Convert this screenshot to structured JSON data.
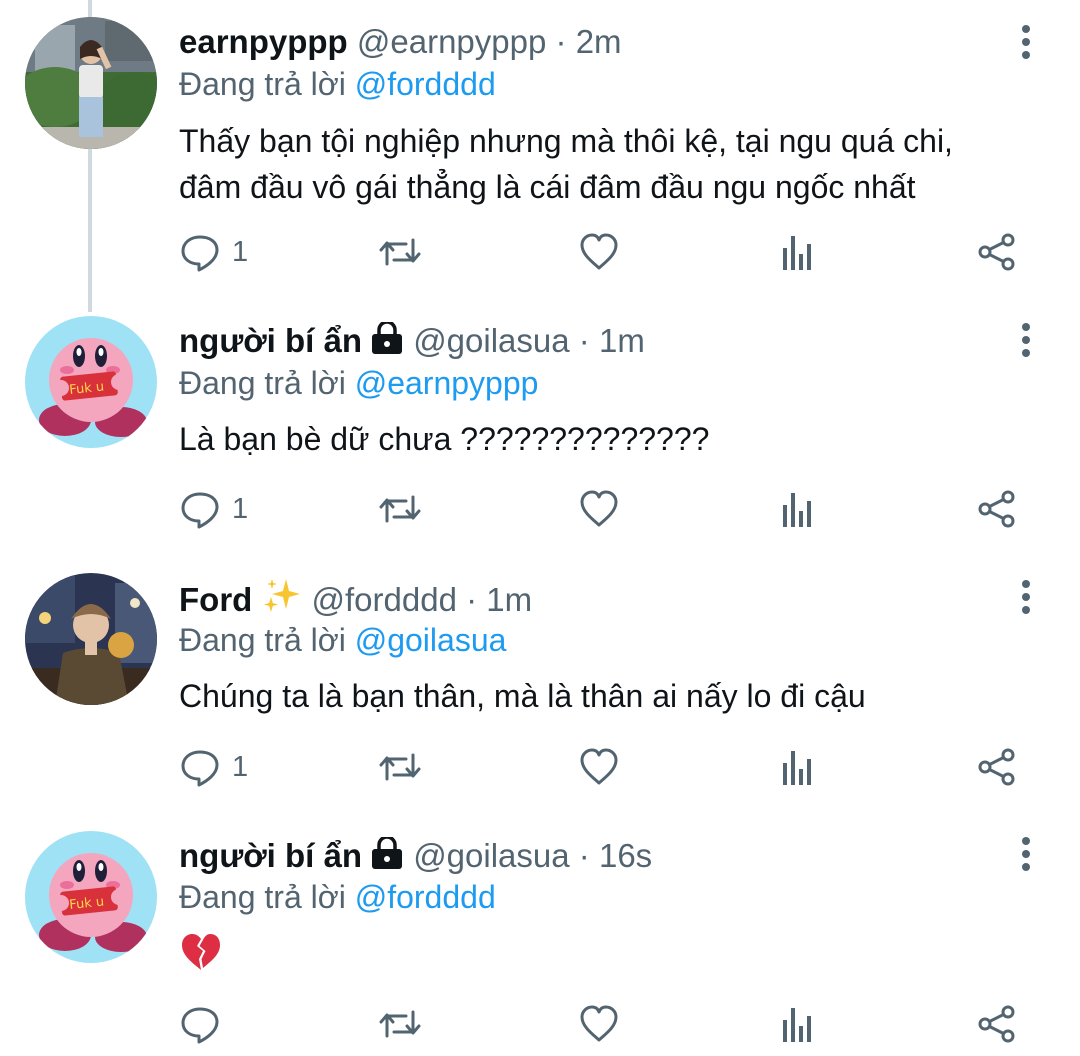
{
  "ui": {
    "reply_prefix": "Đang trả lời"
  },
  "tweets": [
    {
      "name": "earnpyppp",
      "handle": "@earnpyppp",
      "sep": "·",
      "time": "2m",
      "reply_to": "@fordddd",
      "text_lines": [
        "Thấy bạn tội nghiệp nhưng mà thôi kệ, tại ngu quá chi,",
        "đâm đầu vô gái thẳng là cái đâm đầu ngu ngốc nhất"
      ],
      "reply_count": "1",
      "avatar": "photo-girl-avatar"
    },
    {
      "name": "người bí ẩn",
      "handle": "@goilasua",
      "sep": "·",
      "time": "1m",
      "reply_to": "@earnpyppp",
      "text_lines": [
        "Là bạn bè dữ chưa ??????????????"
      ],
      "reply_count": "1",
      "avatar": "kirby-avatar",
      "locked": true,
      "avatar_text": "Fuk u"
    },
    {
      "name": "Ford",
      "handle": "@fordddd",
      "sep": "·",
      "time": "1m",
      "reply_to": "@goilasua",
      "text_lines": [
        "Chúng ta là bạn thân, mà là thân ai nấy lo đi cậu"
      ],
      "reply_count": "1",
      "avatar": "photo-man-avatar"
    },
    {
      "name": "người bí ẩn",
      "handle": "@goilasua",
      "sep": "·",
      "time": "16s",
      "reply_to": "@fordddd",
      "text_emoji": "broken-heart",
      "reply_count": "",
      "avatar": "kirby-avatar",
      "locked": true,
      "avatar_text": "Fuk u"
    }
  ],
  "icons": {
    "reply": "reply-icon",
    "retweet": "retweet-icon",
    "like": "heart-icon",
    "analytics": "analytics-icon",
    "share": "share-icon",
    "more": "more-vertical-icon"
  },
  "colors": {
    "link": "#1d9bf0",
    "secondary": "#536471",
    "text": "#0f1419"
  }
}
